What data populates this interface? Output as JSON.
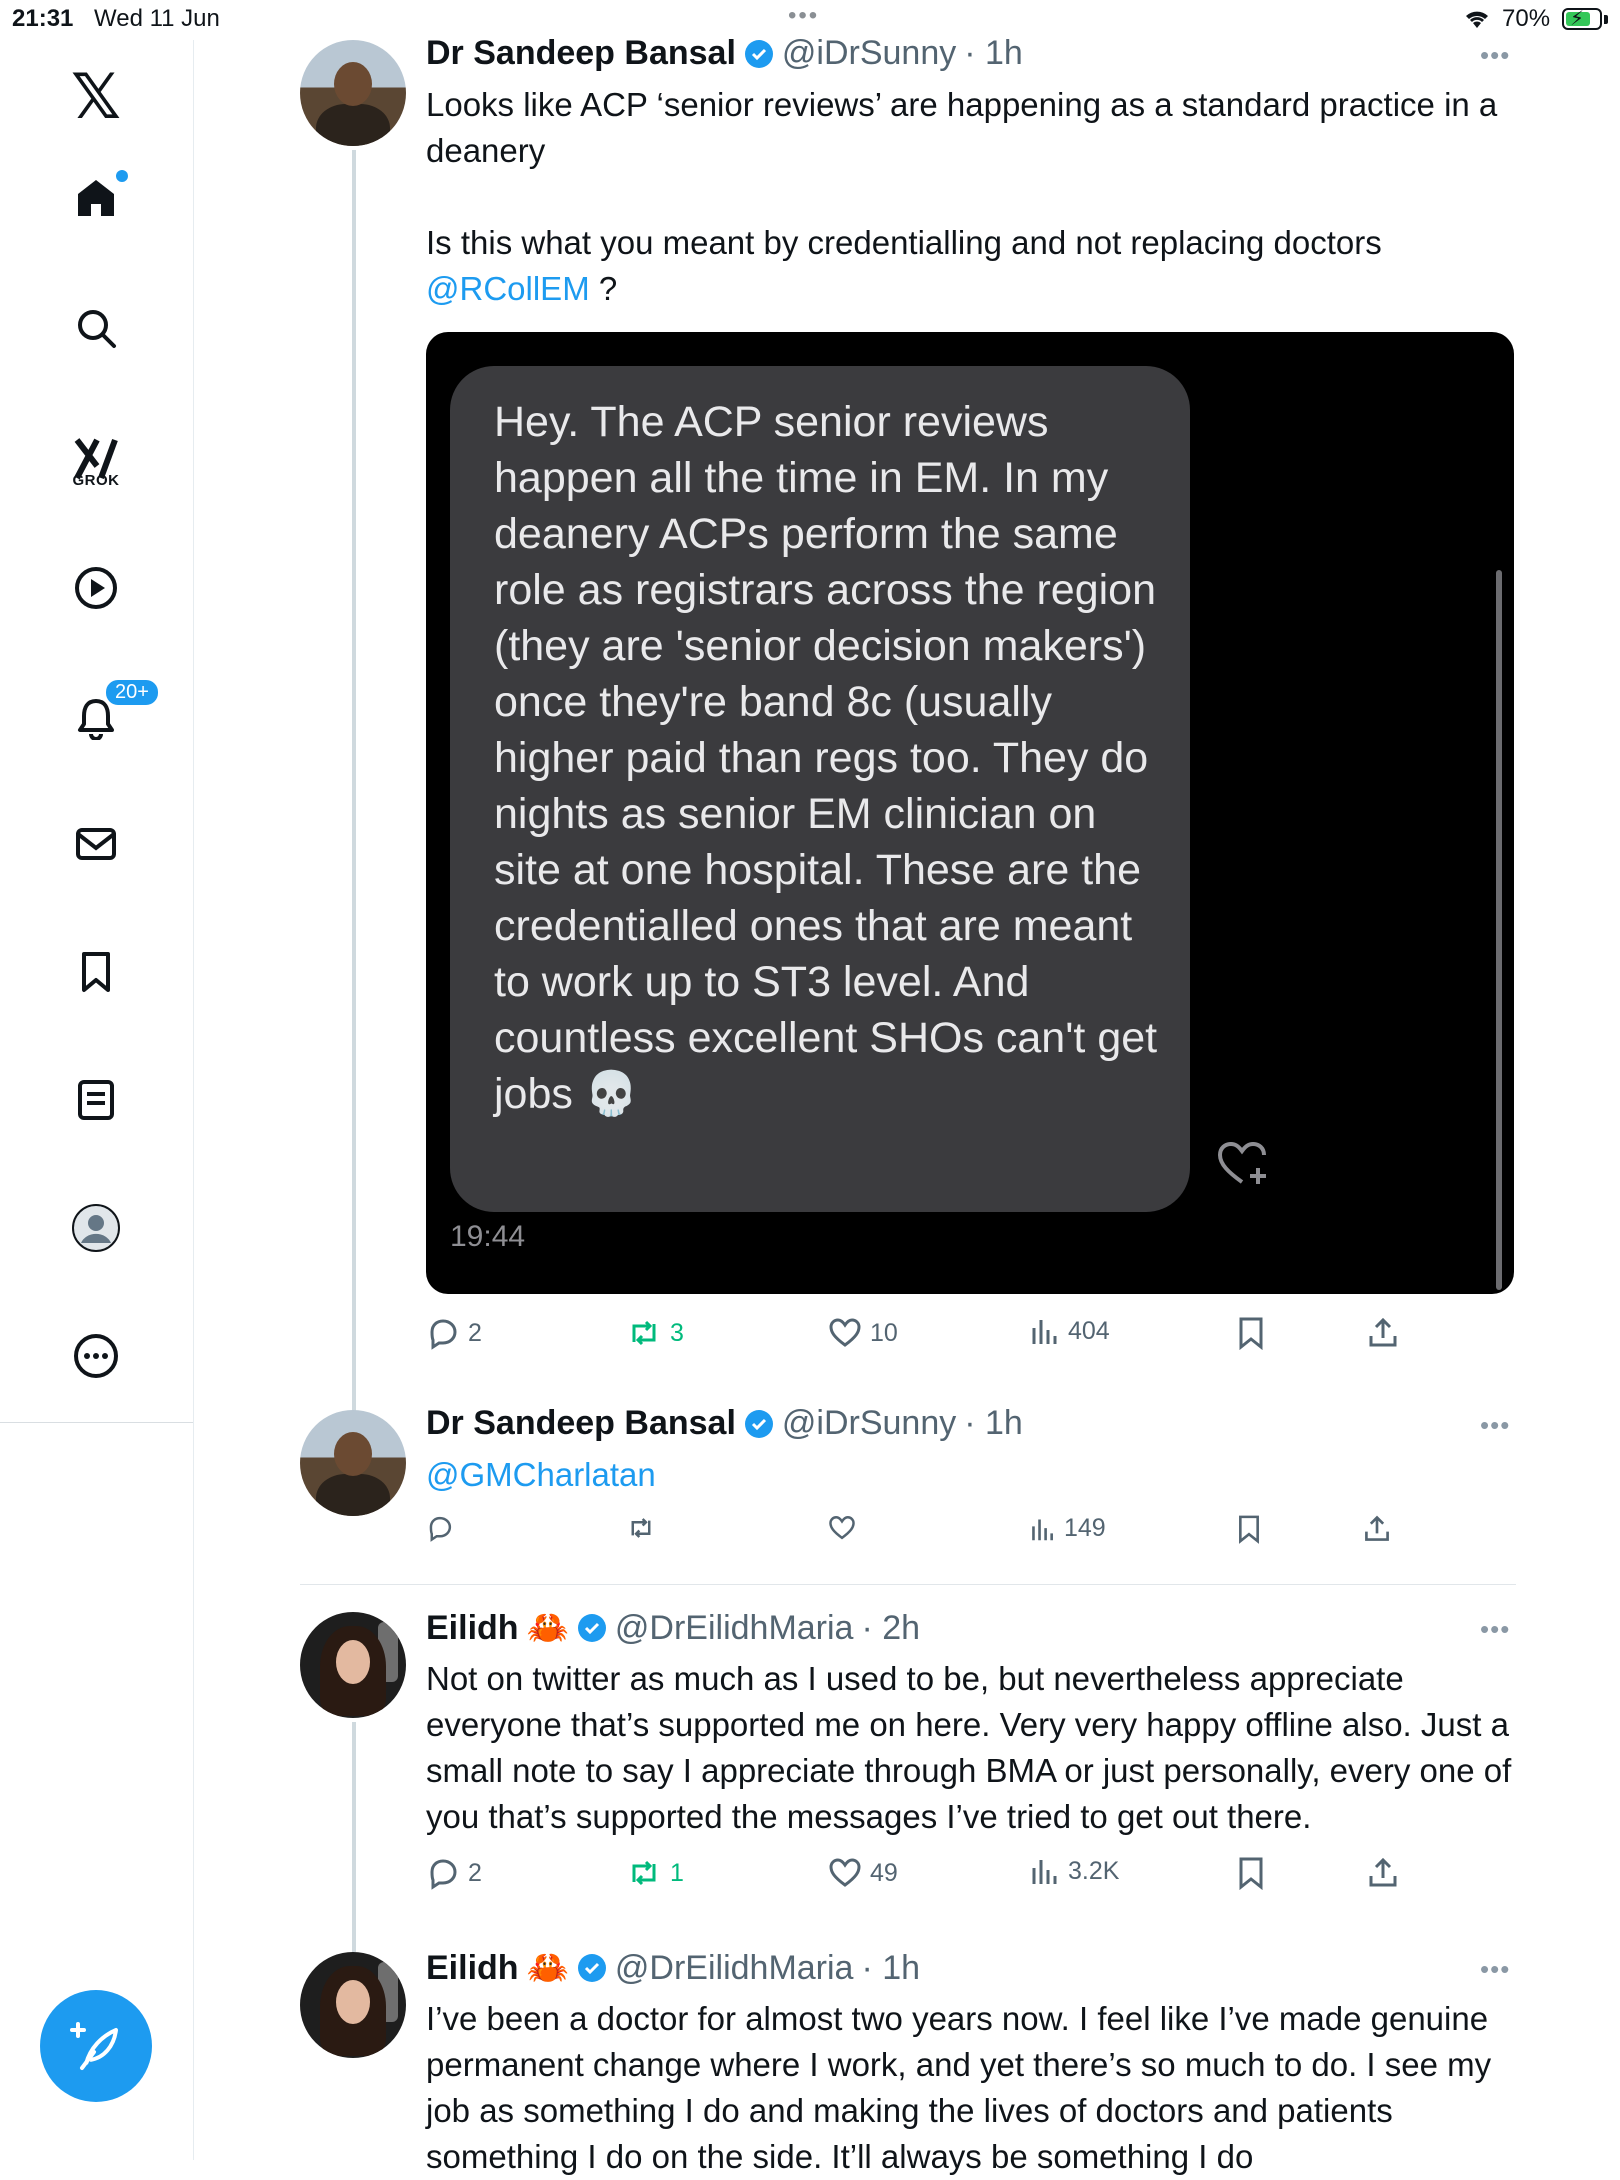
{
  "status_bar": {
    "time": "21:31",
    "date": "Wed 11 Jun",
    "battery": "70%"
  },
  "sidebar": {
    "grok_label": "GROK",
    "notification_badge": "20+"
  },
  "tweets": [
    {
      "name": "Dr Sandeep Bansal",
      "handle": "@iDrSunny",
      "time": "· 1h",
      "text": "Looks like ACP ‘senior reviews’ are happening as a standard practice in a deanery\n\nIs this what you meant by credentialling and not replacing doctors",
      "mention": "@RCollEM",
      "text_tail": " ?",
      "image": {
        "message": "Hey. The ACP senior reviews happen all the time in EM. In my deanery ACPs perform the same role as registrars across the region (they are 'senior decision makers') once they're band 8c (usually higher paid than regs too. They do nights as senior EM clinician on site at one hospital. These are the credentialled ones that are meant to work up to ST3 level. And countless excellent SHOs can't get jobs 💀",
        "timestamp": "19:44"
      },
      "replies": "2",
      "reposts": "3",
      "likes": "10",
      "views": "404"
    },
    {
      "name": "Dr Sandeep Bansal",
      "handle": "@iDrSunny",
      "time": "· 1h",
      "mention": "@GMCharlatan",
      "views": "149"
    },
    {
      "name": "Eilidh",
      "emoji": "🦀",
      "handle": "@DrEilidhMaria",
      "time": "· 2h",
      "text": "Not on twitter as much as I used to be, but nevertheless appreciate everyone that’s supported me on here. Very very happy offline also. Just a small note to say I appreciate through BMA or just personally, every one of you that’s supported the messages I’ve tried to get out there.",
      "replies": "2",
      "reposts": "1",
      "likes": "49",
      "views": "3.2K"
    },
    {
      "name": "Eilidh",
      "emoji": "🦀",
      "handle": "@DrEilidhMaria",
      "time": "· 1h",
      "text": "I’ve been a doctor for almost two years now. I feel like I’ve made genuine permanent change where I work, and yet there’s so much to do. I see my job as something I do and making the lives of doctors and patients something I do on the side. It’ll always be something I do"
    }
  ],
  "colors": {
    "accent": "#1d9bf0",
    "repost": "#00ba7c",
    "secondary_text": "#536471"
  },
  "icons": [
    "x-logo-icon",
    "home-icon",
    "search-icon",
    "grok-icon",
    "video-icon",
    "bell-icon",
    "mail-icon",
    "bookmark-icon",
    "lists-icon",
    "profile-icon",
    "more-icon",
    "compose-icon",
    "verified-icon",
    "reply-icon",
    "repost-icon",
    "like-icon",
    "views-icon",
    "share-icon"
  ]
}
